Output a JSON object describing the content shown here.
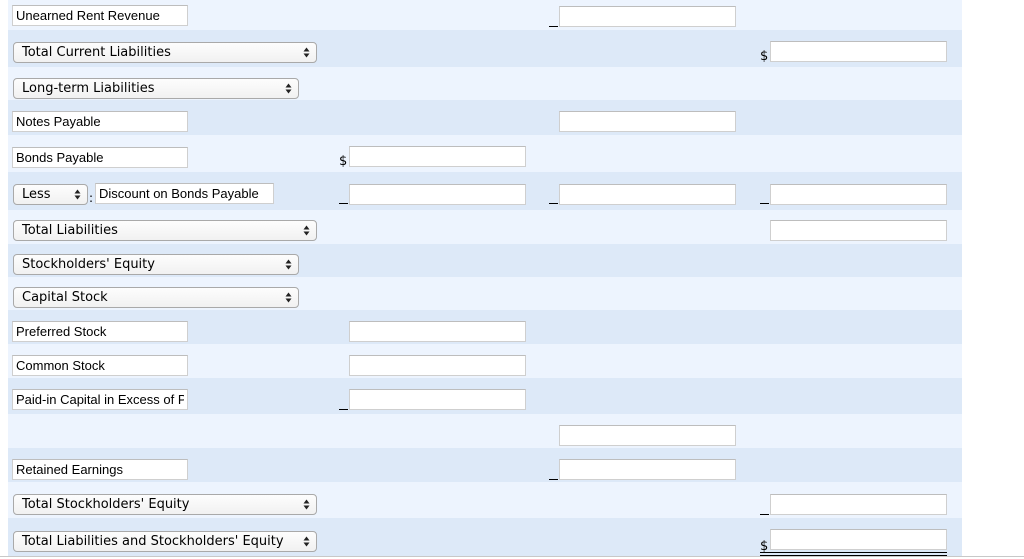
{
  "form": {
    "rows": [
      {
        "label": "Unearned Rent Revenue",
        "col2_prefix": "_",
        "col2_value": ""
      },
      {
        "select": "Total Current Liabilities",
        "col3_prefix": "$",
        "col3_value": ""
      },
      {
        "select": "Long-term Liabilities"
      },
      {
        "label": "Notes Payable",
        "col2_value": ""
      },
      {
        "label": "Bonds Payable",
        "col1_prefix": "$",
        "col1_value": ""
      },
      {
        "select": "Less",
        "separator": ":",
        "label": "Discount on Bonds Payable",
        "col1_prefix": "_",
        "col1_value": "",
        "col2_prefix": "_",
        "col2_value": "",
        "col3_prefix": "_",
        "col3_value": ""
      },
      {
        "select": "Total Liabilities",
        "col3_value": ""
      },
      {
        "select": "Stockholders' Equity"
      },
      {
        "select": "Capital Stock"
      },
      {
        "label": "Preferred Stock",
        "col1_value": ""
      },
      {
        "label": "Common Stock",
        "col1_value": ""
      },
      {
        "label": "Paid-in Capital in Excess of Par",
        "col1_prefix": "_",
        "col1_value": ""
      },
      {
        "col2_value": ""
      },
      {
        "label": "Retained Earnings",
        "col2_prefix": "_",
        "col2_value": ""
      },
      {
        "select": "Total Stockholders' Equity",
        "col3_prefix": "_",
        "col3_value": ""
      },
      {
        "select": "Total Liabilities and Stockholders' Equity",
        "col3_prefix": "$",
        "col3_value": ""
      }
    ]
  },
  "colors": {
    "row_light": "#edf4fe",
    "row_dark": "#dde9f8"
  }
}
